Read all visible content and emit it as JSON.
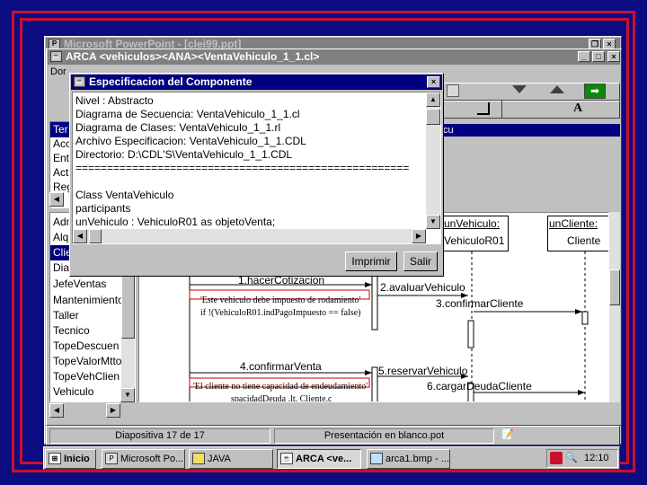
{
  "ppt_window": {
    "title": "Microsoft PowerPoint - [clei99.ppt]"
  },
  "arca_window": {
    "title": "ARCA <vehiculos><ANA><VentaVehiculo_1_1.cl>",
    "menu_item": "Dor",
    "left_list_top": [
      "Ter",
      "Acc",
      "Ent",
      "Acte",
      "Reg"
    ],
    "left_list_bottom": [
      "Adm",
      "Alq",
      "Clie",
      "Dia",
      "JefeVentas",
      "Mantenimiento",
      "Taller",
      "Tecnico",
      "TopeDescuen",
      "TopeValorMtto",
      "TopeVehClien",
      "Vehiculo"
    ],
    "selected_index": 2,
    "center_header_fragment": "cu",
    "toolbar_letter": "A"
  },
  "dialog": {
    "title": "Especificacion del Componente",
    "lines": [
      "Nivel : Abstracto",
      "Diagrama de Secuencia: VentaVehiculo_1_1.cl",
      "Diagrama de Clases: VentaVehiculo_1_1.rl",
      "Archivo Especificacion: VentaVehiculo_1_1.CDL",
      "Directorio: D:\\CDL'S\\VentaVehiculo_1_1.CDL",
      "=====================================================",
      "",
      "Class VentaVehiculo",
      "participants",
      "   unVehiculo : VehiculoR01 as objetoVenta;"
    ],
    "print_button": "Imprimir",
    "exit_button": "Salir"
  },
  "diagram": {
    "obj1_name": "unVehiculo:",
    "obj1_class": "VehiculoR01",
    "obj2_name": "unCliente:",
    "obj2_class": "Cliente",
    "msg_top": "1.hacerCotizacion",
    "note1": "'Este vehiculo debe impuesto de rodamiento'",
    "cond1": "if !(VehiculoR01.indPagoImpuesto == false)",
    "msg2": "2.avaluarVehiculo",
    "msg3": "3.confirmarCliente",
    "msg4": "4.confirmarVenta",
    "msg5": "5.reservarVehiculo",
    "note2": "'El cliente no tiene capacidad de endeudamiento'",
    "cond2": "spacidadDeuda .lt. Cliente.c",
    "msg6": "6.cargarDeudaCliente"
  },
  "statusbar": {
    "slide": "Diapositiva 17 de 17",
    "template": "Presentación en blanco.pot"
  },
  "taskbar": {
    "start": "Inicio",
    "tasks": [
      "Microsoft Po...",
      "JAVA",
      "ARCA <ve...",
      "arca1.bmp - ..."
    ],
    "clock": "12:10"
  },
  "colors": {
    "background": "#0c0c82",
    "frame": "#c8102e",
    "titlebar": "#000080",
    "window": "#c0c0c0"
  }
}
